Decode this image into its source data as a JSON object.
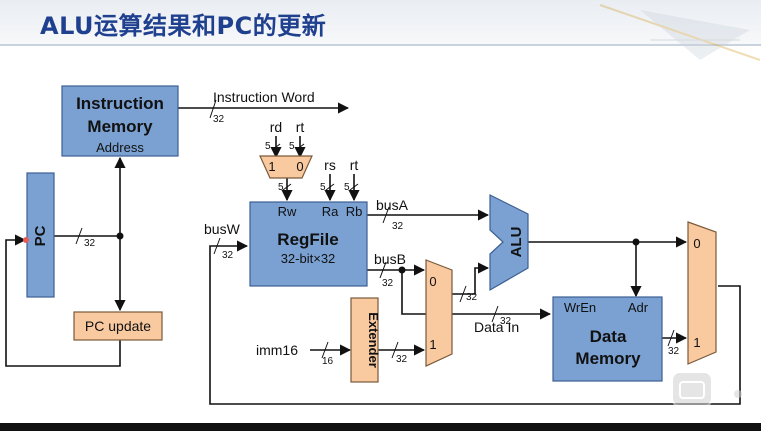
{
  "title": "ALU运算结果和PC的更新",
  "blocks": {
    "instruction_memory": {
      "title_line1": "Instruction",
      "title_line2": "Memory",
      "port": "Address"
    },
    "pc": "PC",
    "pc_update": "PC update",
    "regfile": {
      "title": "RegFile",
      "subtitle": "32-bit×32",
      "port_rw": "Rw",
      "port_ra": "Ra",
      "port_rb": "Rb"
    },
    "mux_rd_rt": {
      "in1": "1",
      "in0": "0"
    },
    "mux_alu_src": {
      "in0": "0",
      "in1": "1"
    },
    "alu": "ALU",
    "extender": "Extender",
    "data_memory": {
      "title_line1": "Data",
      "title_line2": "Memory",
      "port_wren": "WrEn",
      "port_adr": "Adr"
    },
    "mux_wb": {
      "in0": "0",
      "in1": "1"
    }
  },
  "signals": {
    "instruction_word": "Instruction Word",
    "rd": "rd",
    "rt_top": "rt",
    "rs": "rs",
    "rt": "rt",
    "busA": "busA",
    "busB": "busB",
    "busW": "busW",
    "imm16": "imm16",
    "data_in": "Data In"
  },
  "bus_widths": {
    "w32": "32",
    "w5": "5",
    "w16": "16"
  },
  "colors": {
    "title": "#1f3f8f",
    "blue_block": "#7aa1d2",
    "blue_block_border": "#3d5f92",
    "orange_block": "#f9c9a0",
    "orange_block_border": "#7a5a3a",
    "wire": "#111111"
  }
}
